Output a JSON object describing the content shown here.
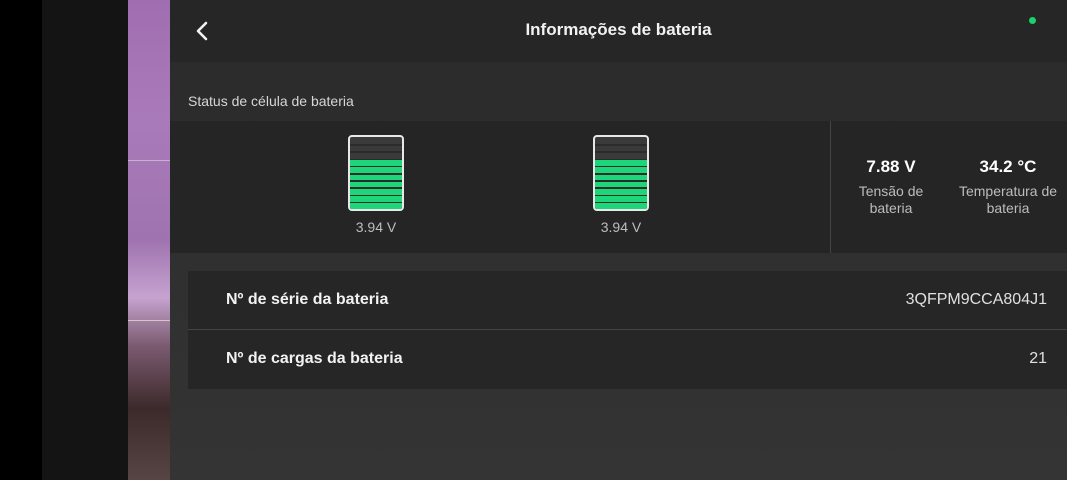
{
  "header": {
    "title": "Informações de bateria"
  },
  "status_indicator_color": "#19d36a",
  "cells_section": {
    "label": "Status de célula de bateria",
    "cells": [
      {
        "voltage": "3.94 V",
        "level": 0.7
      },
      {
        "voltage": "3.94 V",
        "level": 0.7
      }
    ]
  },
  "stats": {
    "voltage": {
      "value": "7.88 V",
      "label": "Tensão de bateria"
    },
    "temperature": {
      "value": "34.2 °C",
      "label": "Temperatura de bateria"
    }
  },
  "info_rows": [
    {
      "key": "Nº de série da bateria",
      "value": "3QFPM9CCA804J1"
    },
    {
      "key": "Nº de cargas da bateria",
      "value": "21"
    }
  ],
  "accent_color": "#1ed67a"
}
